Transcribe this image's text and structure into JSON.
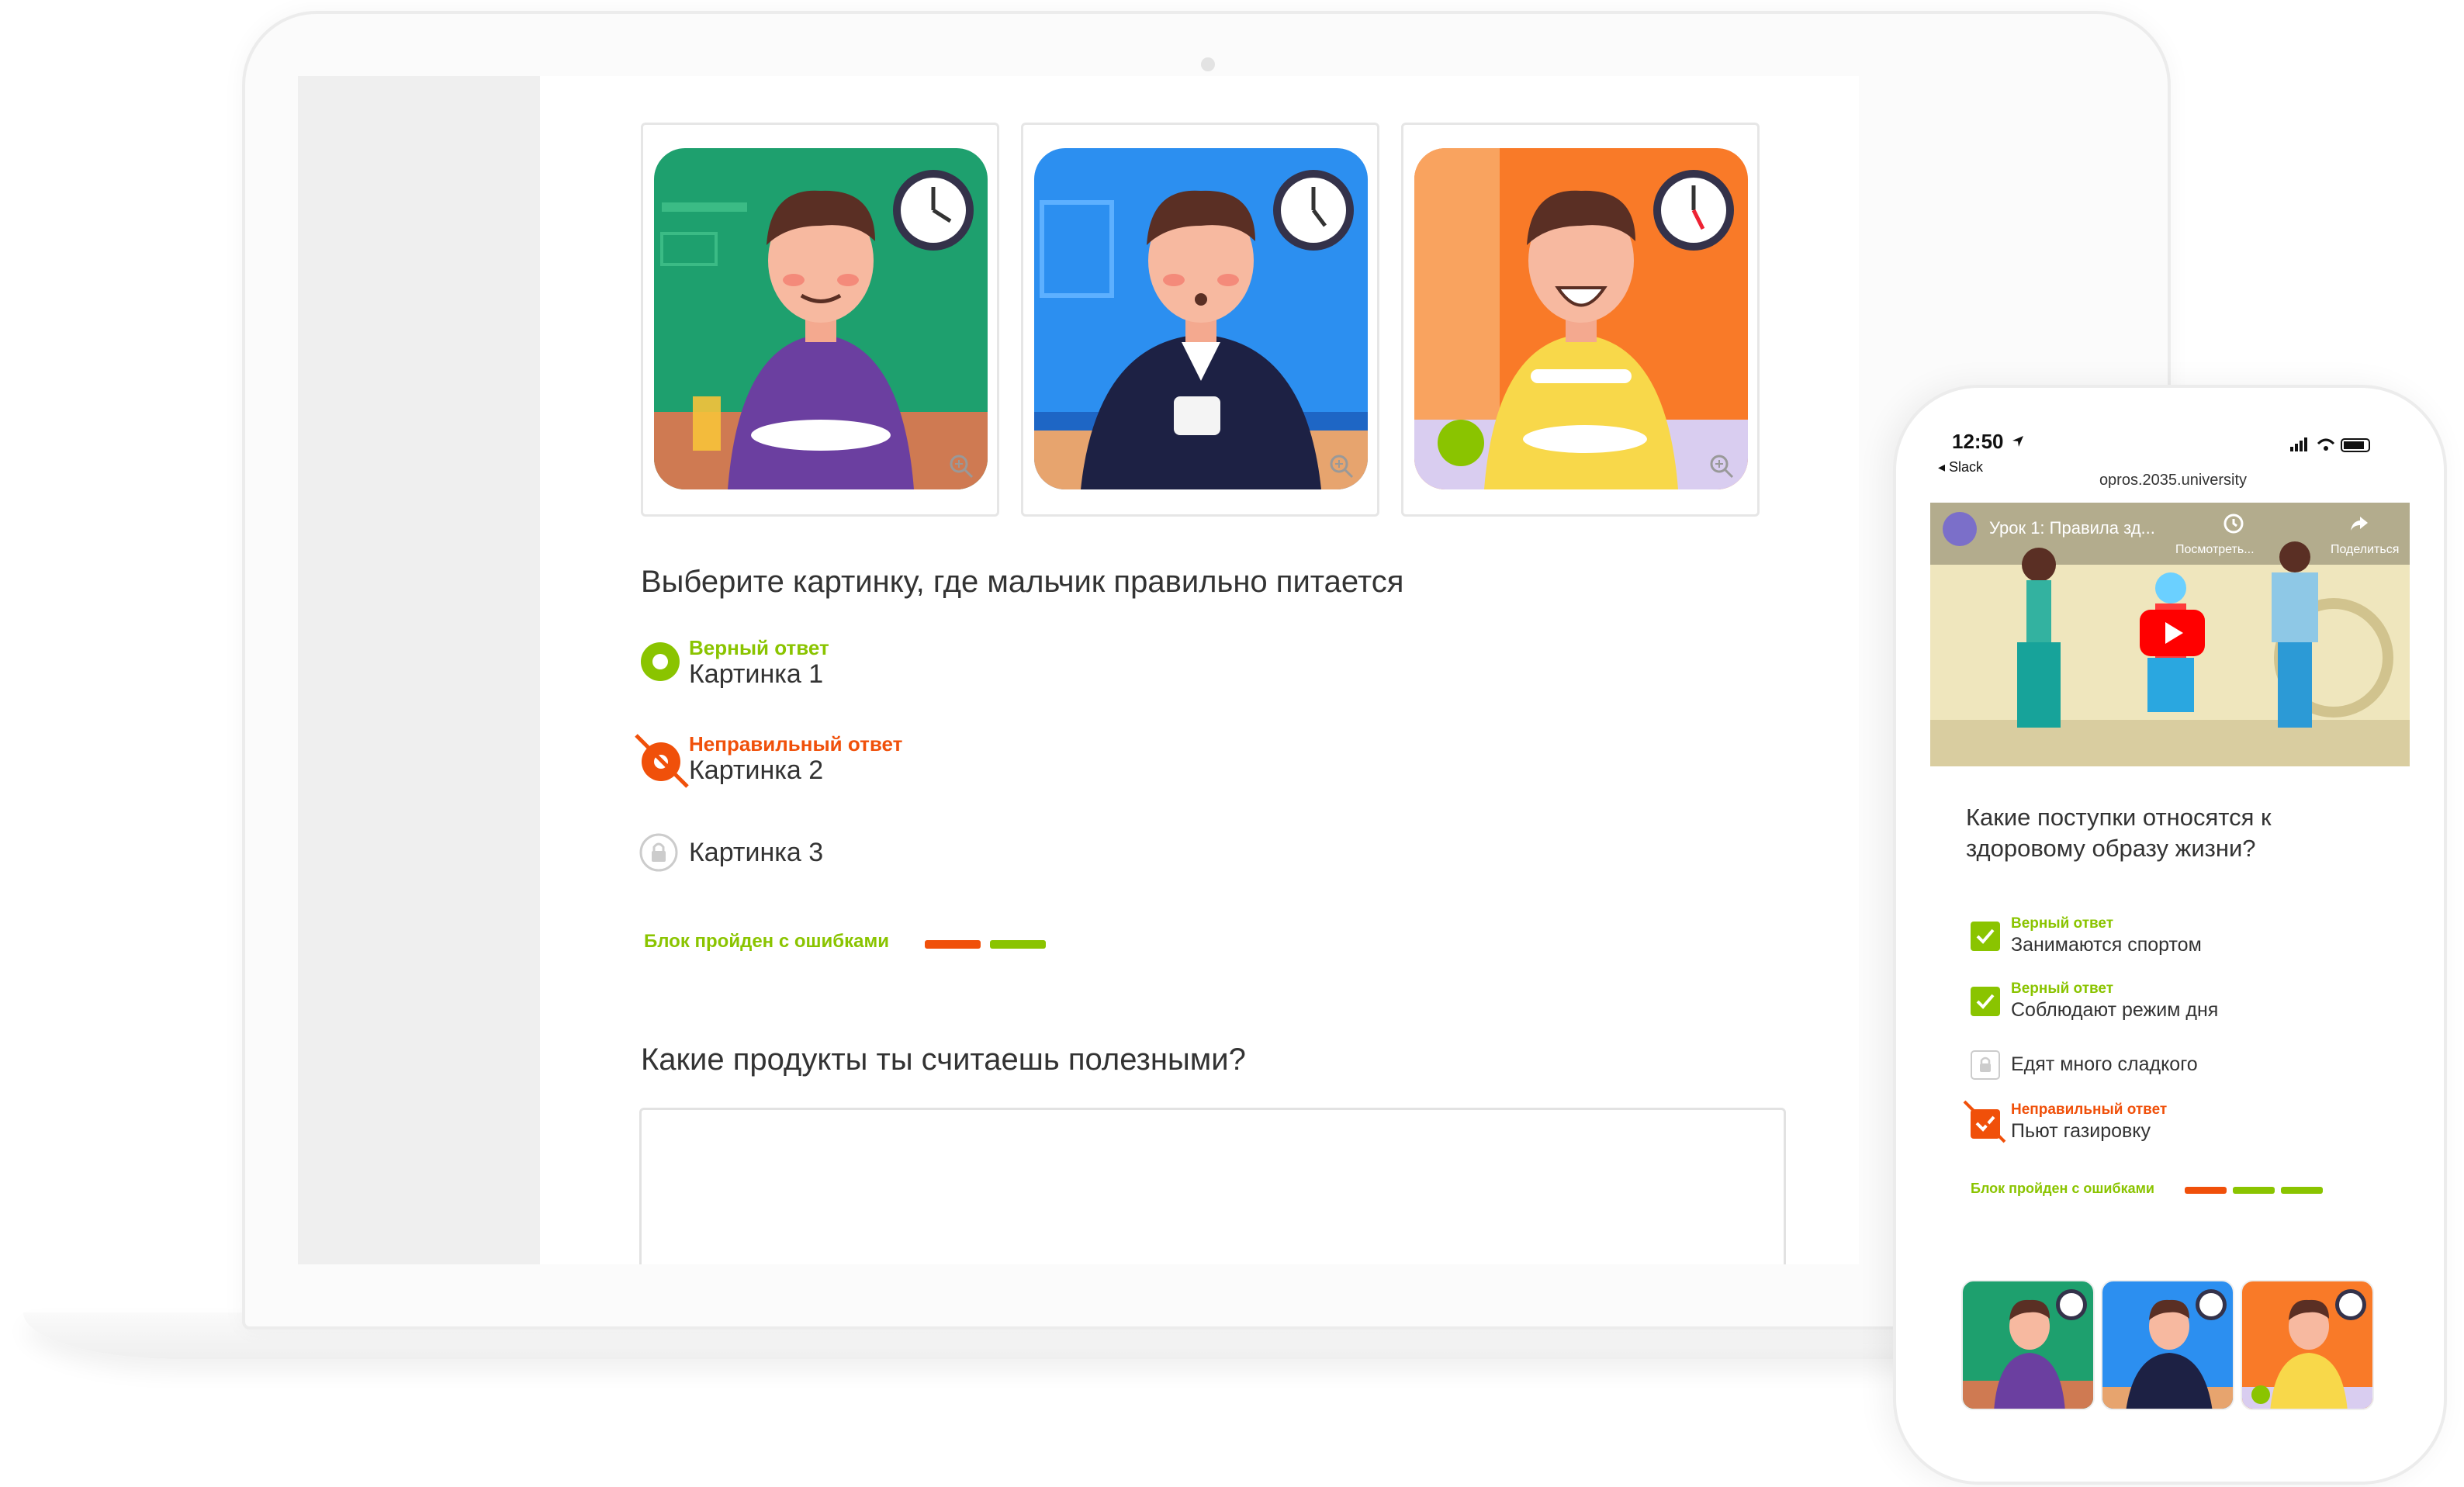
{
  "desktop": {
    "question1": "Выберите картинку, где мальчик правильно питается",
    "options": [
      {
        "status": "Верный ответ",
        "label": "Картинка 1",
        "state": "correct"
      },
      {
        "status": "Неправильный ответ",
        "label": "Картинка 2",
        "state": "wrong"
      },
      {
        "status": "",
        "label": "Картинка 3",
        "state": "locked"
      }
    ],
    "summary": "Блок пройден с ошибками",
    "question2": "Какие продукты ты считаешь полезными?"
  },
  "mobile": {
    "time": "12:50",
    "back_app": "◂ Slack",
    "url": "opros.2035.university",
    "video_title": "Урок 1: Правила зд...",
    "video_watch_later": "Посмотреть...",
    "video_share": "Поделиться",
    "question": "Какие поступки относятся к здоровому образу жизни?",
    "options": [
      {
        "status": "Верный ответ",
        "label": "Занимаются спортом",
        "state": "correct"
      },
      {
        "status": "Верный ответ",
        "label": "Соблюдают режим дня",
        "state": "correct"
      },
      {
        "status": "",
        "label": "Едят много сладкого",
        "state": "locked"
      },
      {
        "status": "Неправильный ответ",
        "label": "Пьют газировку",
        "state": "wrong"
      }
    ],
    "summary": "Блок пройден с ошибками"
  },
  "colors": {
    "correct": "#8ac400",
    "wrong": "#f0500a",
    "locked": "#bbbbbb",
    "scene_green": "#1ea06e",
    "scene_blue": "#2c8ff0",
    "scene_orange": "#f97a28"
  },
  "icons": [
    "zoom-icon",
    "radio-correct-icon",
    "wrong-answer-icon",
    "lock-icon",
    "checkbox-correct-icon",
    "youtube-play-icon",
    "clock-icon"
  ]
}
